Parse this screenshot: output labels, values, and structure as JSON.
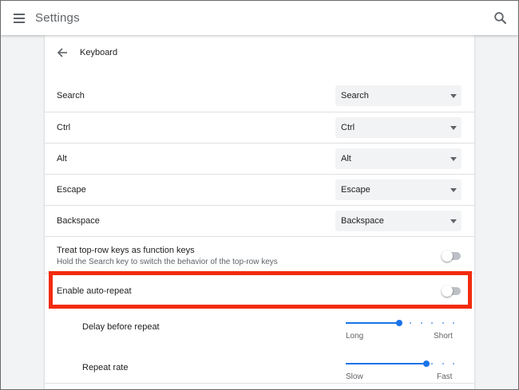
{
  "header": {
    "title": "Settings",
    "menu_icon": "menu-icon",
    "search_icon": "search-icon"
  },
  "subpage": {
    "back_icon": "arrow-back-icon",
    "title": "Keyboard"
  },
  "key_remaps": [
    {
      "label": "Search",
      "value": "Search"
    },
    {
      "label": "Ctrl",
      "value": "Ctrl"
    },
    {
      "label": "Alt",
      "value": "Alt"
    },
    {
      "label": "Escape",
      "value": "Escape"
    },
    {
      "label": "Backspace",
      "value": "Backspace"
    }
  ],
  "function_keys": {
    "label": "Treat top-row keys as function keys",
    "description": "Hold the Search key to switch the behavior of the top-row keys",
    "enabled": false
  },
  "auto_repeat": {
    "label": "Enable auto-repeat",
    "enabled": false
  },
  "delay": {
    "label": "Delay before repeat",
    "min_label": "Long",
    "max_label": "Short",
    "value_fraction": 0.5
  },
  "repeat_rate": {
    "label": "Repeat rate",
    "min_label": "Slow",
    "max_label": "Fast",
    "value_fraction": 0.75
  },
  "colors": {
    "accent": "#1a73e8",
    "highlight": "#f22b0d"
  }
}
